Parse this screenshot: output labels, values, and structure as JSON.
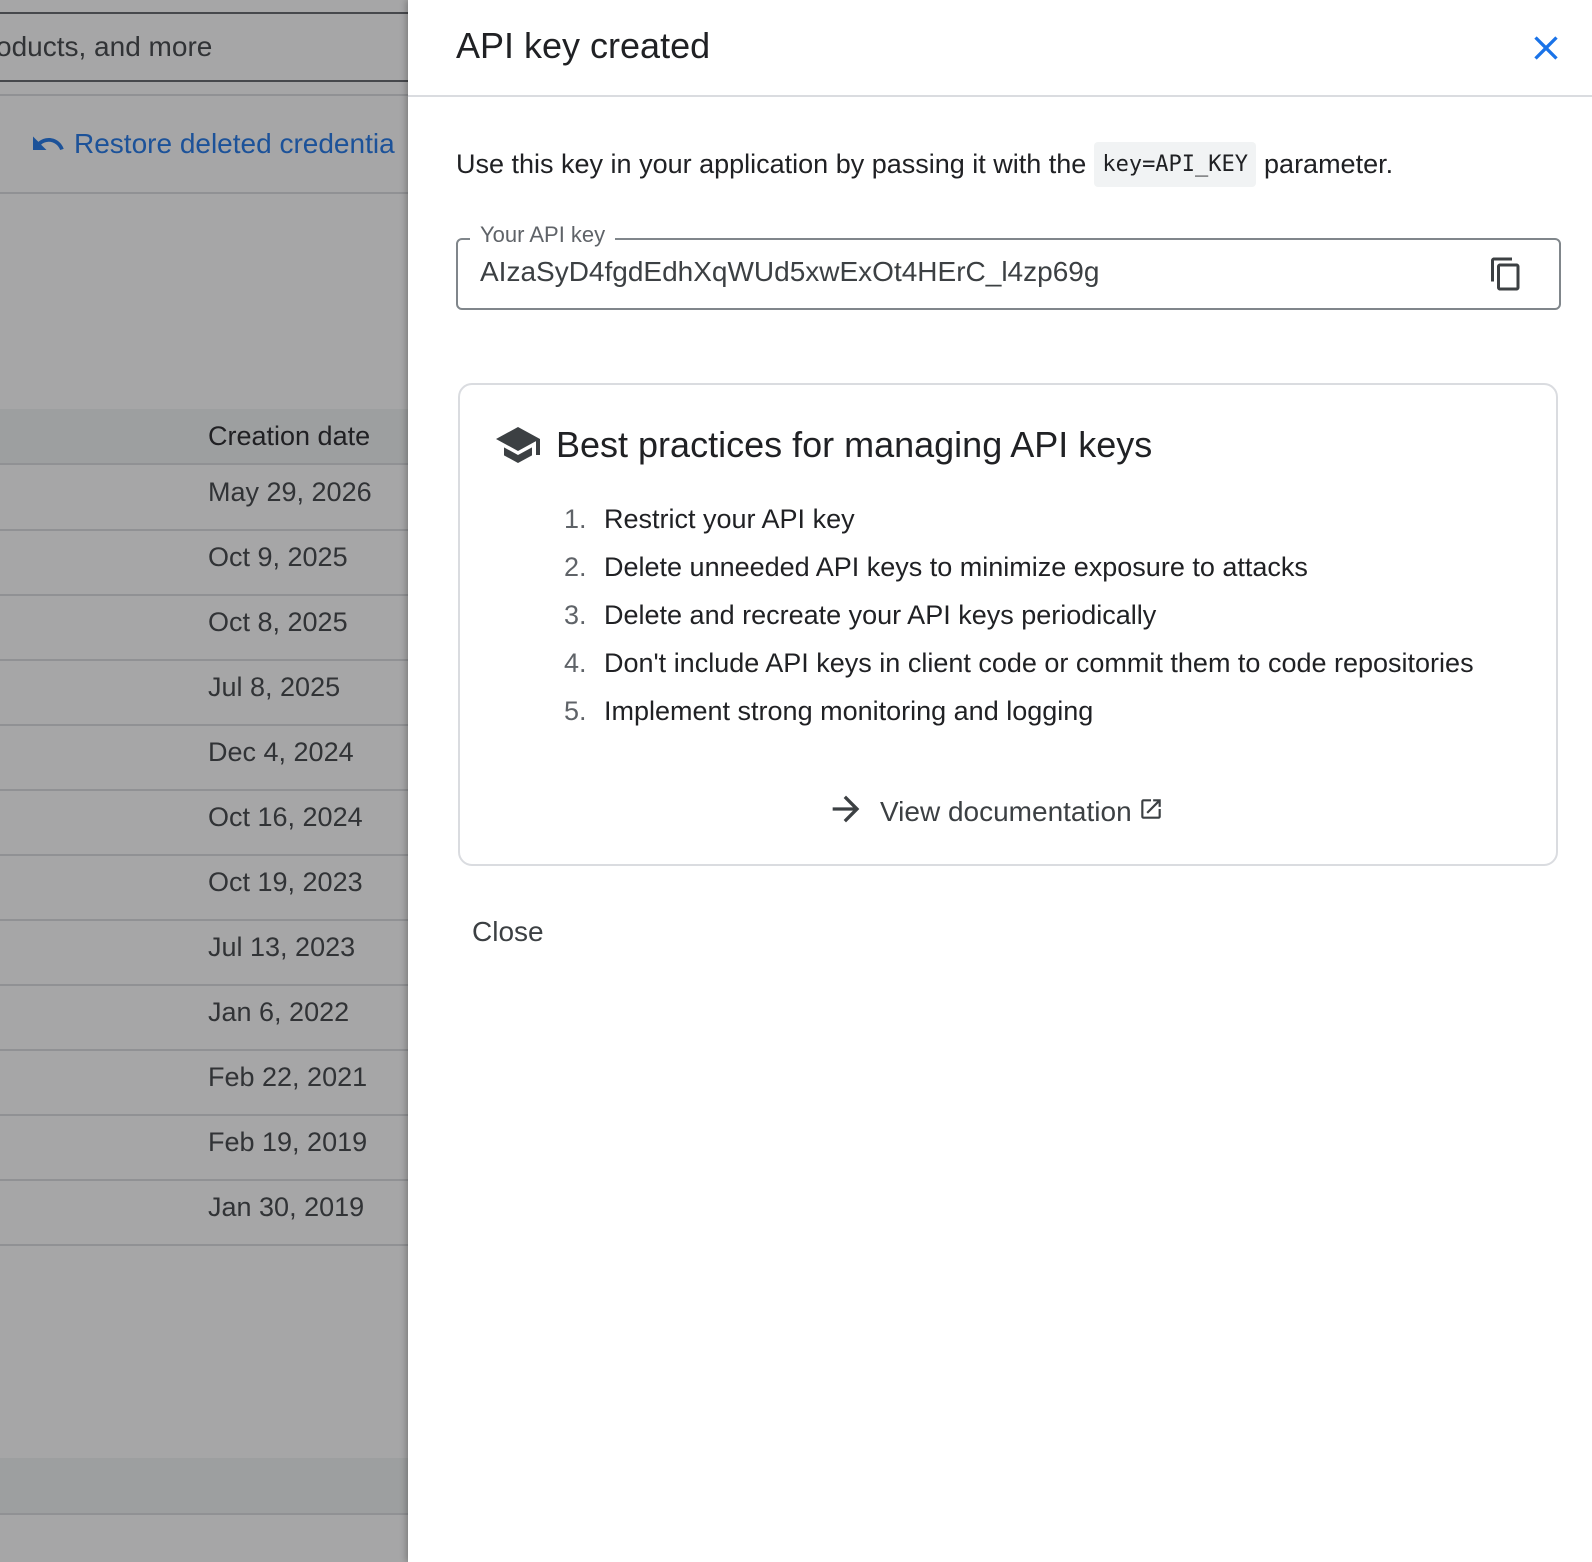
{
  "background": {
    "search_text": "oducts, and more",
    "restore_label": "Restore deleted credentia",
    "table": {
      "column_header": "Creation date",
      "rows": [
        "May 29, 2026",
        "Oct 9, 2025",
        "Oct 8, 2025",
        "Jul 8, 2025",
        "Dec 4, 2024",
        "Oct 16, 2024",
        "Oct 19, 2023",
        "Jul 13, 2023",
        "Jan 6, 2022",
        "Feb 22, 2021",
        "Feb 19, 2019",
        "Jan 30, 2019"
      ]
    }
  },
  "panel": {
    "title": "API key created",
    "intro_before": "Use this key in your application by passing it with the",
    "intro_code": "key=API_KEY",
    "intro_after": "parameter.",
    "key_field": {
      "label": "Your API key",
      "value": "AIzaSyD4fgdEdhXqWUd5xwExOt4HErC_l4zp69g"
    },
    "best_practices": {
      "heading": "Best practices for managing API keys",
      "tips": [
        {
          "num": "1.",
          "text": "Restrict your API key"
        },
        {
          "num": "2.",
          "text": "Delete unneeded API keys to minimize exposure to attacks"
        },
        {
          "num": "3.",
          "text": "Delete and recreate your API keys periodically"
        },
        {
          "num": "4.",
          "text": "Don't include API keys in client code or commit them to code repositories"
        },
        {
          "num": "5.",
          "text": "Implement strong monitoring and logging"
        }
      ],
      "view_doc_label": "View documentation"
    },
    "close_label": "Close"
  },
  "icons": {
    "close": "close-icon",
    "copy": "copy-icon",
    "school": "school-icon",
    "arrow": "arrow-forward-icon",
    "external": "open-in-new-icon",
    "undo": "undo-icon"
  },
  "colors": {
    "accent": "#1a73e8",
    "text": "#202124",
    "secondary": "#5f6368"
  }
}
